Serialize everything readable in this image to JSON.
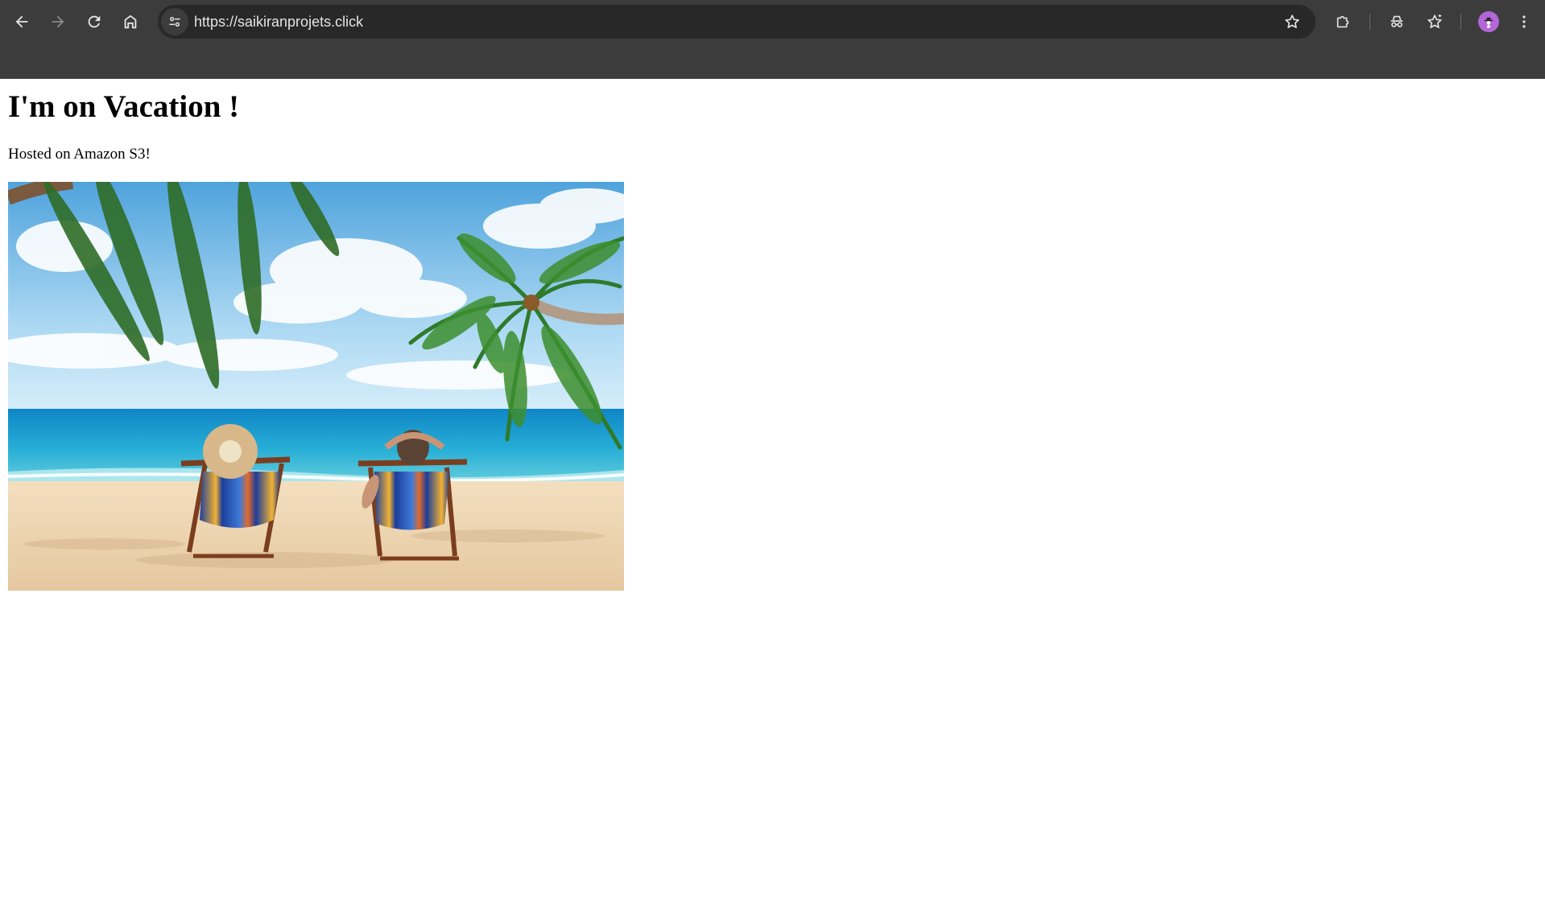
{
  "browser": {
    "url": "https://saikiranprojets.click",
    "icons": {
      "back": "arrow-left-icon",
      "forward": "arrow-right-icon",
      "reload": "reload-icon",
      "home": "home-icon",
      "site_info": "tune-icon",
      "bookmark": "star-icon",
      "extensions": "puzzle-icon",
      "incognito": "incognito-icon",
      "bookmarks": "bookmarks-star-icon",
      "profile": "avatar-icon",
      "menu": "kebab-menu-icon"
    },
    "colors": {
      "frame": "#3c3c3c",
      "omnibox": "#282828",
      "avatar": "#b266d8"
    }
  },
  "page": {
    "heading": "I'm on Vacation !",
    "subtitle": "Hosted on Amazon S3!",
    "image": {
      "alt": ""
    }
  }
}
